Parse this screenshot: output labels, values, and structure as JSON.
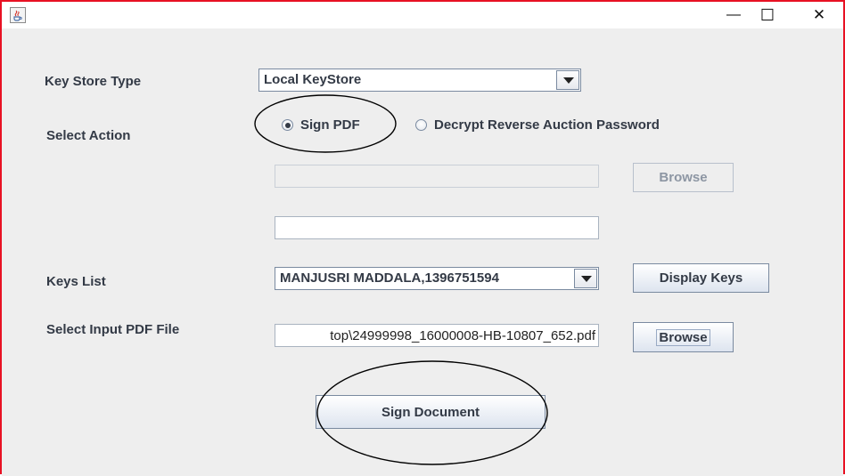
{
  "window": {
    "icon": "java-coffee-cup-icon",
    "controls": {
      "minimize": "—",
      "maximize": "☐",
      "close": "✕"
    },
    "frame_color": "#e81123"
  },
  "form": {
    "key_store_type": {
      "label": "Key Store Type",
      "selected": "Local KeyStore"
    },
    "select_action": {
      "label": "Select Action",
      "options": [
        "Sign PDF",
        "Decrypt Reverse Auction Password"
      ],
      "selected": "Sign PDF"
    },
    "disabled_path": {
      "value": "",
      "browse_label": "Browse"
    },
    "password_field": {
      "value": ""
    },
    "keys_list": {
      "label": "Keys List",
      "selected": "MANJUSRI MADDALA,1396751594",
      "display_label": "Display Keys"
    },
    "input_pdf": {
      "label": "Select Input PDF File",
      "value": "top\\24999998_16000008-HB-10807_652.pdf",
      "browse_label": "Browse"
    },
    "sign_button": {
      "label": "Sign Document"
    }
  }
}
